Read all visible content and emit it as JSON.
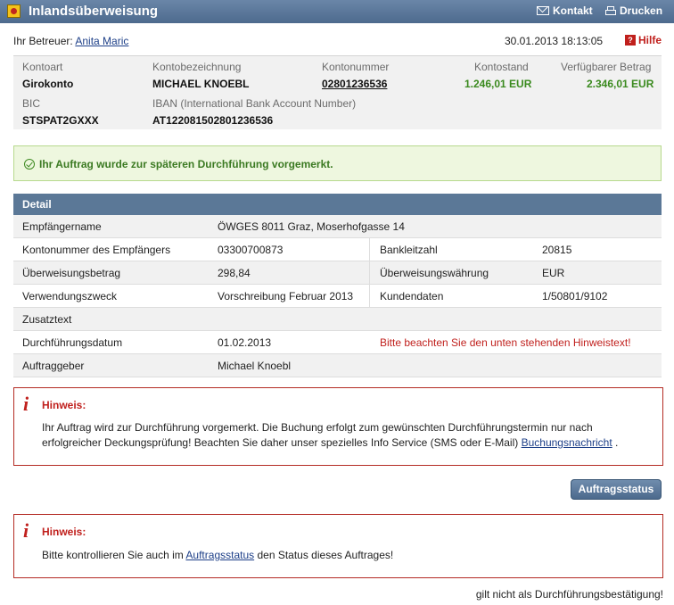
{
  "header": {
    "title": "Inlandsüberweisung",
    "contact_label": "Kontakt",
    "print_label": "Drucken"
  },
  "advisor": {
    "label": "Ihr Betreuer:",
    "name": "Anita Maric",
    "datetime": "30.01.2013 18:13:05",
    "help_label": "Hilfe"
  },
  "account": {
    "kontoart_label": "Kontoart",
    "kontoart": "Girokonto",
    "bezeichnung_label": "Kontobezeichnung",
    "bezeichnung": "MICHAEL KNOEBL",
    "nummer_label": "Kontonummer",
    "nummer": "02801236536",
    "stand_label": "Kontostand",
    "stand": "1.246,01 EUR",
    "verfuegbar_label": "Verfügbarer Betrag",
    "verfuegbar": "2.346,01 EUR",
    "bic_label": "BIC",
    "bic": "STSPAT2GXXX",
    "iban_label": "IBAN (International Bank Account Number)",
    "iban": "AT122081502801236536"
  },
  "success_message": "Ihr Auftrag wurde zur späteren Durchführung vorgemerkt.",
  "detail": {
    "title": "Detail",
    "rows": [
      {
        "l1": "Empfängername",
        "v1": "ÖWGES 8011 Graz, Moserhofgasse 14"
      },
      {
        "l1": "Kontonummer des Empfängers",
        "v1": "03300700873",
        "l2": "Bankleitzahl",
        "v2": "20815"
      },
      {
        "l1": "Überweisungsbetrag",
        "v1": "298,84",
        "l2": "Überweisungswährung",
        "v2": "EUR"
      },
      {
        "l1": "Verwendungszweck",
        "v1": "Vorschreibung Februar 2013",
        "l2": "Kundendaten",
        "v2": "1/50801/9102"
      },
      {
        "l1": "Zusatztext",
        "v1": ""
      },
      {
        "l1": "Durchführungsdatum",
        "v1": "01.02.2013",
        "warn": "Bitte beachten Sie den unten stehenden Hinweistext!"
      },
      {
        "l1": "Auftraggeber",
        "v1": "Michael Knoebl"
      }
    ]
  },
  "notice1": {
    "title": "Hinweis:",
    "text_line1": "Ihr Auftrag wird zur Durchführung vorgemerkt. Die Buchung erfolgt zum gewünschten Durchführungstermin nur nach",
    "text_line2": "erfolgreicher Deckungsprüfung! Beachten Sie daher unser spezielles Info Service (SMS oder E-Mail) ",
    "link": "Buchungsnachricht",
    "text_end": " ."
  },
  "status_button": "Auftragsstatus",
  "notice2": {
    "title": "Hinweis:",
    "text_before": "Bitte kontrollieren Sie auch im ",
    "link": "Auftragsstatus",
    "text_after": " den Status dieses Auftrages!"
  },
  "footer_note": "gilt nicht als Durchführungsbestätigung!"
}
